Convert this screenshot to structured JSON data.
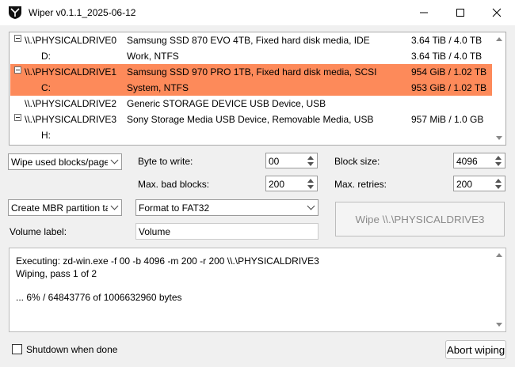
{
  "window": {
    "title": "Wiper v0.1.1_2025-06-12"
  },
  "drives": [
    {
      "name": "\\\\.\\PHYSICALDRIVE0",
      "description": "Samsung SSD 870 EVO 4TB, Fixed hard disk media, IDE",
      "size": "3.64 TiB / 4.0 TB",
      "partition": {
        "letter": "D:",
        "label": "Work, NTFS",
        "size": "3.64 TiB / 4.0 TB"
      }
    },
    {
      "name": "\\\\.\\PHYSICALDRIVE1",
      "description": "Samsung SSD 970 PRO 1TB, Fixed hard disk media, SCSI",
      "size": "954 GiB / 1.02 TB",
      "partition": {
        "letter": "C:",
        "label": "System, NTFS",
        "size": "953 GiB / 1.02 TB"
      }
    },
    {
      "name": "\\\\.\\PHYSICALDRIVE2",
      "description": "Generic STORAGE DEVICE USB Device, USB",
      "size": ""
    },
    {
      "name": "\\\\.\\PHYSICALDRIVE3",
      "description": "Sony Storage Media USB Device, Removable Media, USB",
      "size": "957 MiB / 1.0 GB",
      "partition": {
        "letter": "H:",
        "label": "",
        "size": ""
      }
    }
  ],
  "selection": {
    "highlight_color": "#fd8a5a"
  },
  "options": {
    "wipe_mode": "Wipe used blocks/page",
    "byte_to_write_label": "Byte to write:",
    "byte_to_write": "00",
    "max_bad_blocks_label": "Max. bad blocks:",
    "max_bad_blocks": "200",
    "block_size_label": "Block size:",
    "block_size": "4096",
    "max_retries_label": "Max. retries:",
    "max_retries": "200",
    "partition_table": "Create MBR partition ta",
    "format": "Format to FAT32",
    "volume_label_label": "Volume label:",
    "volume_label": "Volume",
    "wipe_button": "Wipe \\\\.\\PHYSICALDRIVE3"
  },
  "log": {
    "lines": [
      "Executing: zd-win.exe -f 00 -b 4096 -m 200 -r 200 \\\\.\\PHYSICALDRIVE3",
      "Wiping, pass 1 of 2",
      "",
      "... 6% / 64843776 of 1006632960 bytes"
    ]
  },
  "footer": {
    "shutdown_label": "Shutdown when done",
    "shutdown_checked": false,
    "abort_button": "Abort wiping"
  },
  "icons": {
    "app": "shield-icon",
    "minimize": "minimize-icon",
    "maximize": "maximize-icon",
    "close": "close-icon"
  }
}
